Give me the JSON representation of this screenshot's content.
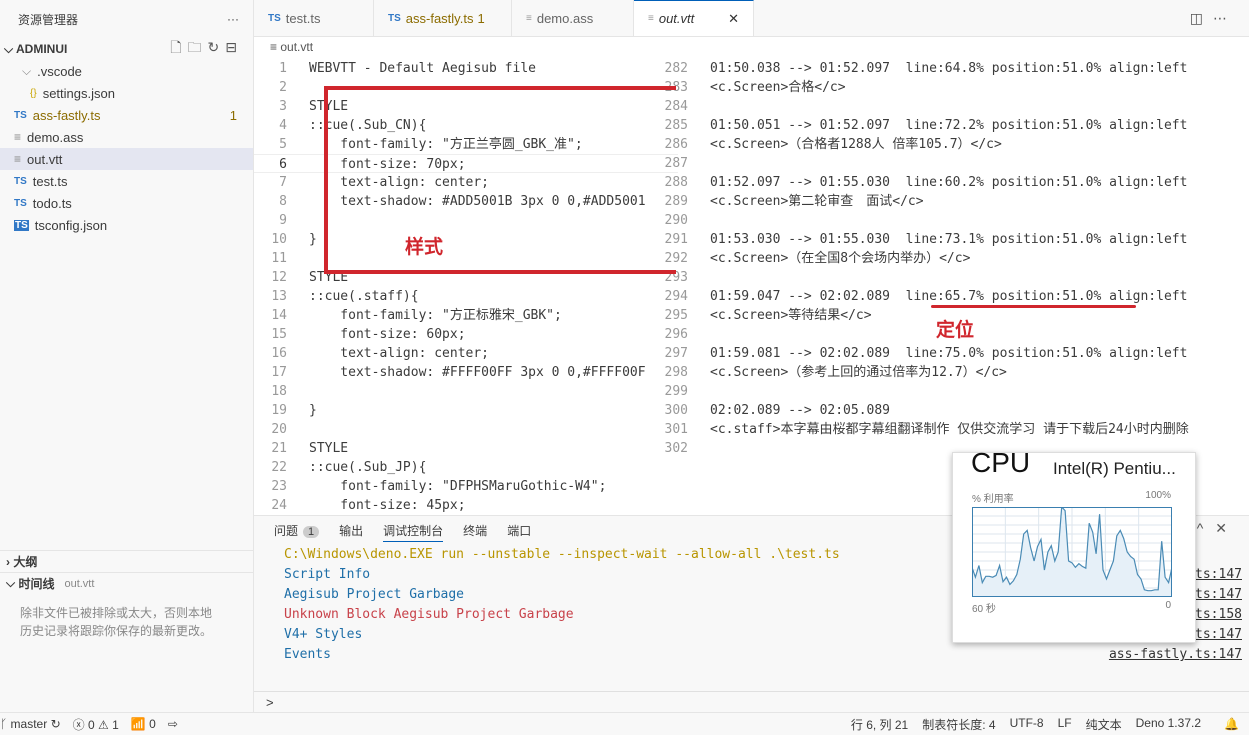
{
  "sidebar": {
    "title": "资源管理器",
    "more": "···",
    "root": "ADMINUI",
    "items": [
      {
        "label": ".vscode",
        "icon": "folder",
        "indent": 1
      },
      {
        "label": "settings.json",
        "icon": "json",
        "indent": 2
      },
      {
        "label": "ass-fastly.ts",
        "icon": "ts",
        "badge": "1",
        "modified": true
      },
      {
        "label": "demo.ass",
        "icon": "file"
      },
      {
        "label": "out.vtt",
        "icon": "file",
        "selected": true
      },
      {
        "label": "test.ts",
        "icon": "ts"
      },
      {
        "label": "todo.ts",
        "icon": "ts"
      },
      {
        "label": "tsconfig.json",
        "icon": "tsconfig"
      }
    ],
    "outline": "大纲",
    "timeline": "时间线",
    "timeline_file": "out.vtt",
    "timeline_msg1": "除非文件已被排除或太大，否则本地",
    "timeline_msg2": "历史记录将跟踪你保存的最新更改。"
  },
  "tabs": [
    {
      "label": "test.ts",
      "icon": "TS"
    },
    {
      "label": "ass-fastly.ts",
      "badge": "1",
      "icon": "TS"
    },
    {
      "label": "demo.ass",
      "icon": "≡"
    },
    {
      "label": "out.vtt",
      "icon": "≡",
      "active": true
    }
  ],
  "breadcrumb": "out.vtt",
  "left_lines": [
    [
      "1",
      "WEBVTT - Default Aegisub file"
    ],
    [
      "2",
      ""
    ],
    [
      "3",
      "STYLE"
    ],
    [
      "4",
      "::cue(.Sub_CN){"
    ],
    [
      "5",
      "    font-family: \"方正兰亭圆_GBK_准\";"
    ],
    [
      "6",
      "    font-size: 70px;"
    ],
    [
      "7",
      "    text-align: center;"
    ],
    [
      "8",
      "    text-shadow: #ADD5001B 3px 0 0,#ADD5001"
    ],
    [
      "9",
      ""
    ],
    [
      "10",
      "}"
    ],
    [
      "11",
      ""
    ],
    [
      "12",
      "STYLE"
    ],
    [
      "13",
      "::cue(.staff){"
    ],
    [
      "14",
      "    font-family: \"方正标雅宋_GBK\";"
    ],
    [
      "15",
      "    font-size: 60px;"
    ],
    [
      "16",
      "    text-align: center;"
    ],
    [
      "17",
      "    text-shadow: #FFFF00FF 3px 0 0,#FFFF00F"
    ],
    [
      "18",
      ""
    ],
    [
      "19",
      "}"
    ],
    [
      "20",
      ""
    ],
    [
      "21",
      "STYLE"
    ],
    [
      "22",
      "::cue(.Sub_JP){"
    ],
    [
      "23",
      "    font-family: \"DFPHSMaruGothic-W4\";"
    ],
    [
      "24",
      "    font-size: 45px;"
    ]
  ],
  "right_lines": [
    [
      "282",
      "01:50.038 --> 01:52.097  line:64.8% position:51.0% align:left"
    ],
    [
      "283",
      "<c.Screen>合格</c>"
    ],
    [
      "284",
      ""
    ],
    [
      "285",
      "01:50.051 --> 01:52.097  line:72.2% position:51.0% align:left"
    ],
    [
      "286",
      "<c.Screen>（合格者1288人 倍率105.7）</c>"
    ],
    [
      "287",
      ""
    ],
    [
      "288",
      "01:52.097 --> 01:55.030  line:60.2% position:51.0% align:left"
    ],
    [
      "289",
      "<c.Screen>第二轮审查　面试</c>"
    ],
    [
      "290",
      ""
    ],
    [
      "291",
      "01:53.030 --> 01:55.030  line:73.1% position:51.0% align:left"
    ],
    [
      "292",
      "<c.Screen>（在全国8个会场内举办）</c>"
    ],
    [
      "293",
      ""
    ],
    [
      "294",
      "01:59.047 --> 02:02.089  line:65.7% position:51.0% align:left"
    ],
    [
      "295",
      "<c.Screen>等待结果</c>"
    ],
    [
      "296",
      ""
    ],
    [
      "297",
      "01:59.081 --> 02:02.089  line:75.0% position:51.0% align:left"
    ],
    [
      "298",
      "<c.Screen>（参考上回的通过倍率为12.7）</c>"
    ],
    [
      "299",
      ""
    ],
    [
      "300",
      "02:02.089 --> 02:05.089"
    ],
    [
      "301",
      "<c.staff>本字幕由桜都字幕组翻译制作 仅供交流学习 请于下载后24小时内删除"
    ],
    [
      "302",
      ""
    ]
  ],
  "annotations": {
    "style_label": "样式",
    "position_label": "定位",
    "color": "#d0262d"
  },
  "panel": {
    "tabs": [
      {
        "label": "问题",
        "badge": "1"
      },
      {
        "label": "输出"
      },
      {
        "label": "调试控制台",
        "active": true
      },
      {
        "label": "终端"
      },
      {
        "label": "端口"
      }
    ],
    "console": [
      {
        "text": "C:\\Windows\\deno.EXE run --unstable --inspect-wait --allow-all .\\test.ts",
        "color": "#b89500"
      },
      {
        "text": "Script Info",
        "color": "#1f6fa8",
        "src": "ts:147"
      },
      {
        "text": "Aegisub Project Garbage",
        "color": "#1f6fa8",
        "src": "ts:147"
      },
      {
        "text": "Unknown Block Aegisub Project Garbage",
        "color": "#c8424a",
        "src": "ts:158"
      },
      {
        "text": "V4+ Styles",
        "color": "#1f6fa8",
        "src": "ts:147"
      },
      {
        "text": "Events",
        "color": "#1f6fa8",
        "src": "ass-fastly.ts:147"
      }
    ],
    "prompt": ">"
  },
  "cpu": {
    "title": "CPU",
    "model": "Intel(R) Pentiu...",
    "ylabel": "% 利用率",
    "ymax": "100%",
    "xleft": "60 秒",
    "xright": "0",
    "values": [
      33,
      22,
      35,
      16,
      23,
      23,
      22,
      24,
      35,
      17,
      22,
      14,
      18,
      25,
      42,
      70,
      74,
      55,
      40,
      56,
      64,
      30,
      50,
      57,
      40,
      50,
      100,
      96,
      40,
      38,
      33,
      37,
      34,
      32,
      82,
      72,
      48,
      92,
      30,
      20,
      30,
      40,
      68,
      74,
      65,
      50,
      45,
      42,
      25,
      20,
      8,
      7,
      7,
      8,
      8,
      62,
      22,
      16,
      33
    ]
  },
  "status": {
    "branch": "master",
    "errors": "0",
    "warnings": "1",
    "ports": "0",
    "position": "行 6, 列 21",
    "tab_size": "制表符长度: 4",
    "encoding": "UTF-8",
    "eol": "LF",
    "language": "纯文本",
    "runtime": "Deno 1.37.2"
  }
}
